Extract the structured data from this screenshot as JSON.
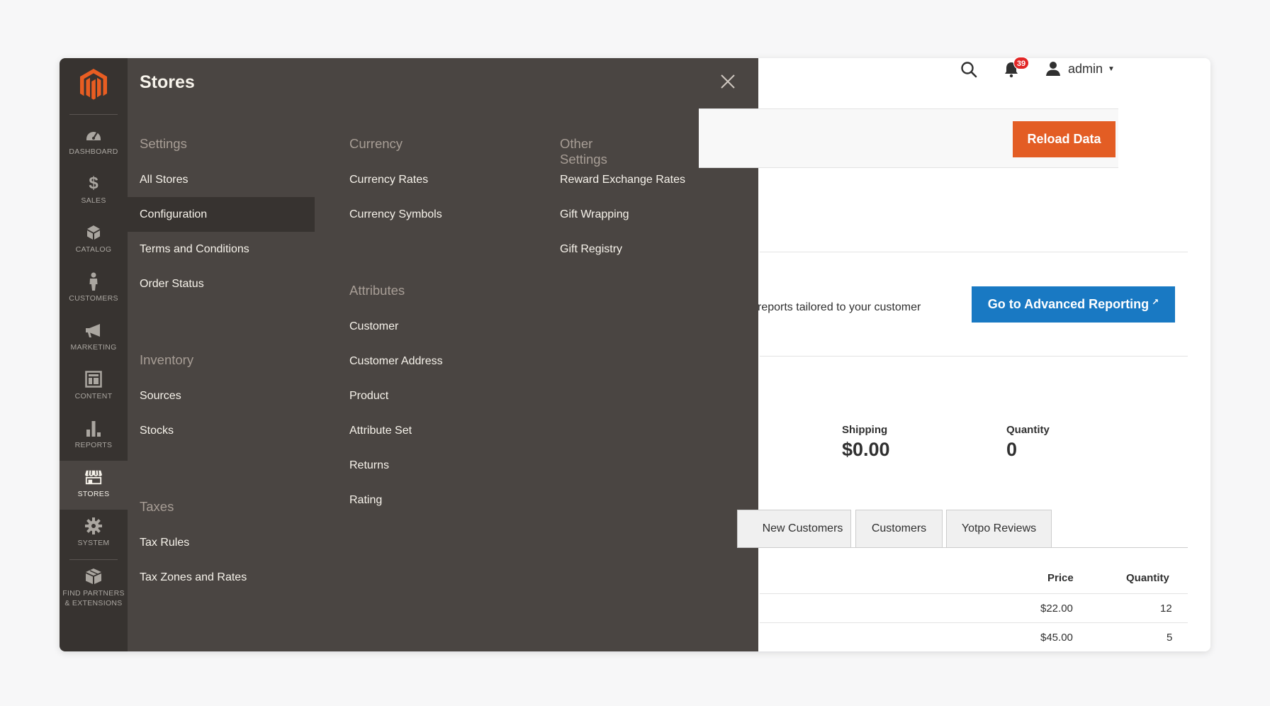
{
  "leftnav": {
    "items": [
      {
        "label": "DASHBOARD",
        "icon": "dashboard-icon"
      },
      {
        "label": "SALES",
        "icon": "dollar-icon"
      },
      {
        "label": "CATALOG",
        "icon": "cube-icon"
      },
      {
        "label": "CUSTOMERS",
        "icon": "person-icon"
      },
      {
        "label": "MARKETING",
        "icon": "megaphone-icon"
      },
      {
        "label": "CONTENT",
        "icon": "layout-icon"
      },
      {
        "label": "REPORTS",
        "icon": "bar-chart-icon"
      },
      {
        "label": "STORES",
        "icon": "storefront-icon"
      },
      {
        "label": "SYSTEM",
        "icon": "gear-icon"
      },
      {
        "label": "FIND PARTNERS & EXTENSIONS",
        "icon": "boxes-icon"
      }
    ],
    "active": "STORES",
    "brand_color": "#e85d22"
  },
  "flyout": {
    "title": "Stores",
    "settings": {
      "title": "Settings",
      "items": [
        "All Stores",
        "Configuration",
        "Terms and Conditions",
        "Order Status"
      ]
    },
    "inventory": {
      "title": "Inventory",
      "items": [
        "Sources",
        "Stocks"
      ]
    },
    "taxes": {
      "title": "Taxes",
      "items": [
        "Tax Rules",
        "Tax Zones and Rates"
      ]
    },
    "currency": {
      "title": "Currency",
      "items": [
        "Currency Rates",
        "Currency Symbols"
      ]
    },
    "attributes": {
      "title": "Attributes",
      "items": [
        "Customer",
        "Customer Address",
        "Product",
        "Attribute Set",
        "Returns",
        "Rating"
      ]
    },
    "other": {
      "title": "Other Settings",
      "items": [
        "Reward Exchange Rates",
        "Gift Wrapping",
        "Gift Registry"
      ]
    },
    "selected": "Configuration"
  },
  "header": {
    "notifications_count": "39",
    "user": "admin"
  },
  "actions": {
    "reload": "Reload Data",
    "advanced_text": "reports tailored to your customer",
    "advanced_button": "Go to Advanced Reporting",
    "accent": "#e35d24",
    "primary": "#1979c3"
  },
  "stats": [
    {
      "label": "Shipping",
      "value": "$0.00"
    },
    {
      "label": "Quantity",
      "value": "0"
    }
  ],
  "tabs": [
    "New Customers",
    "Customers",
    "Yotpo Reviews"
  ],
  "table": {
    "headers": [
      "Price",
      "Quantity"
    ],
    "rows": [
      {
        "price": "$22.00",
        "quantity": "12"
      },
      {
        "price": "$45.00",
        "quantity": "5"
      }
    ]
  }
}
